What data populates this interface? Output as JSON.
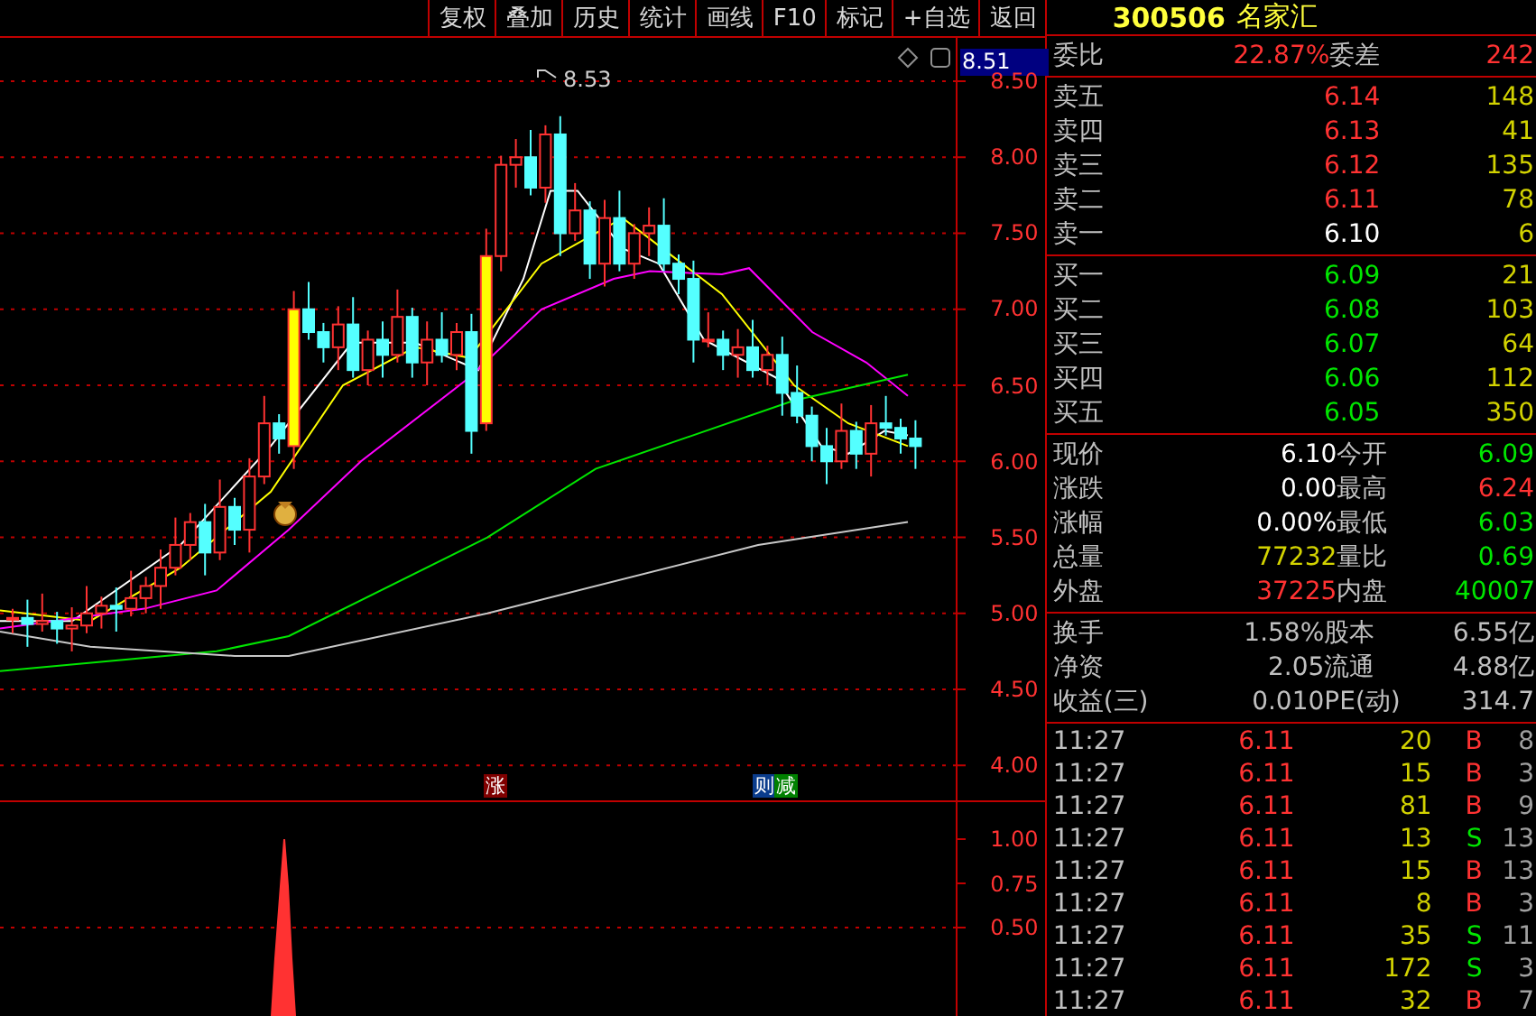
{
  "toolbar": {
    "buttons": [
      "复权",
      "叠加",
      "历史",
      "统计",
      "画线",
      "F10",
      "标记",
      "+自选",
      "返回"
    ]
  },
  "chart": {
    "current_price": "8.51",
    "high_label": "8.53",
    "price_axis": [
      "8.50",
      "8.00",
      "7.50",
      "7.00",
      "6.50",
      "6.00",
      "5.50",
      "5.00",
      "4.50",
      "4.00"
    ],
    "markers": [
      {
        "text": "涨",
        "color": "#800000"
      },
      {
        "text": "则",
        "color": "#0a3c8c"
      },
      {
        "text": "减",
        "color": "#008000"
      }
    ],
    "indicator_axis": [
      "1.00",
      "0.75",
      "0.50"
    ]
  },
  "quote": {
    "code": "300506",
    "name": "名家汇",
    "ratio": {
      "label": "委比",
      "value": "22.87%",
      "label2": "委差",
      "value2": "242"
    },
    "asks": [
      {
        "label": "卖五",
        "price": "6.14",
        "volume": "148",
        "color": "#ff3232"
      },
      {
        "label": "卖四",
        "price": "6.13",
        "volume": "41",
        "color": "#ff3232"
      },
      {
        "label": "卖三",
        "price": "6.12",
        "volume": "135",
        "color": "#ff3232"
      },
      {
        "label": "卖二",
        "price": "6.11",
        "volume": "78",
        "color": "#ff3232"
      },
      {
        "label": "卖一",
        "price": "6.10",
        "volume": "6",
        "color": "#ffffff"
      }
    ],
    "bids": [
      {
        "label": "买一",
        "price": "6.09",
        "volume": "21",
        "color": "#00e600"
      },
      {
        "label": "买二",
        "price": "6.08",
        "volume": "103",
        "color": "#00e600"
      },
      {
        "label": "买三",
        "price": "6.07",
        "volume": "64",
        "color": "#00e600"
      },
      {
        "label": "买四",
        "price": "6.06",
        "volume": "112",
        "color": "#00e600"
      },
      {
        "label": "买五",
        "price": "6.05",
        "volume": "350",
        "color": "#00e600"
      }
    ],
    "stats": [
      {
        "label": "现价",
        "value": "6.10",
        "color": "#ffffff"
      },
      {
        "label": "今开",
        "value": "6.09",
        "color": "#00e600"
      },
      {
        "label": "涨跌",
        "value": "0.00",
        "color": "#ffffff"
      },
      {
        "label": "最高",
        "value": "6.24",
        "color": "#ff3232"
      },
      {
        "label": "涨幅",
        "value": "0.00%",
        "color": "#ffffff"
      },
      {
        "label": "最低",
        "value": "6.03",
        "color": "#00e600"
      },
      {
        "label": "总量",
        "value": "77232",
        "color": "#d2d200"
      },
      {
        "label": "量比",
        "value": "0.69",
        "color": "#00e600"
      },
      {
        "label": "外盘",
        "value": "37225",
        "color": "#ff3232"
      },
      {
        "label": "内盘",
        "value": "40007",
        "color": "#00e600"
      }
    ],
    "fundamentals": [
      {
        "label": "换手",
        "value": "1.58%",
        "label2": "股本",
        "value2": "6.55亿"
      },
      {
        "label": "净资",
        "value": "2.05",
        "label2": "流通",
        "value2": "4.88亿"
      },
      {
        "label": "收益(三)",
        "value": "0.010",
        "label2": "PE(动)",
        "value2": "314.7"
      }
    ],
    "trades": [
      {
        "time": "11:27",
        "price": "6.11",
        "volume": "20",
        "side": "B",
        "kind": "buy",
        "count": "8"
      },
      {
        "time": "11:27",
        "price": "6.11",
        "volume": "15",
        "side": "B",
        "kind": "buy",
        "count": "3"
      },
      {
        "time": "11:27",
        "price": "6.11",
        "volume": "81",
        "side": "B",
        "kind": "buy",
        "count": "9"
      },
      {
        "time": "11:27",
        "price": "6.11",
        "volume": "13",
        "side": "S",
        "kind": "sell",
        "count": "13"
      },
      {
        "time": "11:27",
        "price": "6.11",
        "volume": "15",
        "side": "B",
        "kind": "buy",
        "count": "13"
      },
      {
        "time": "11:27",
        "price": "6.11",
        "volume": "8",
        "side": "B",
        "kind": "buy",
        "count": "3"
      },
      {
        "time": "11:27",
        "price": "6.11",
        "volume": "35",
        "side": "S",
        "kind": "sell",
        "count": "11"
      },
      {
        "time": "11:27",
        "price": "6.11",
        "volume": "172",
        "side": "S",
        "kind": "sell",
        "count": "3"
      },
      {
        "time": "11:27",
        "price": "6.11",
        "volume": "32",
        "side": "B",
        "kind": "buy",
        "count": "7"
      }
    ]
  }
}
